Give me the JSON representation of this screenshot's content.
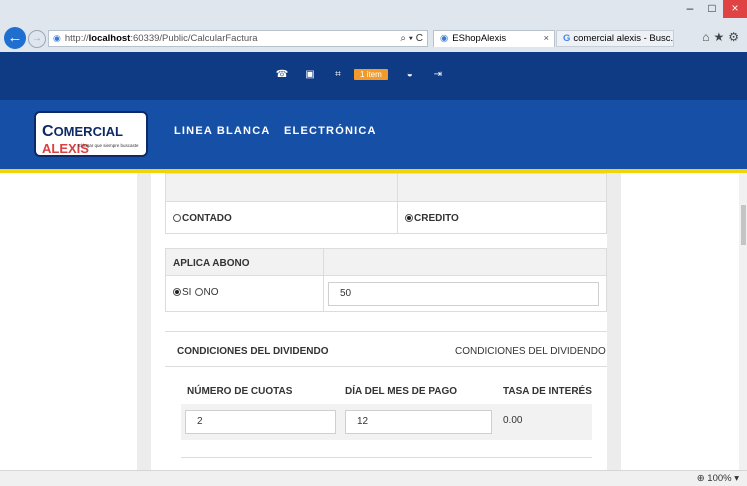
{
  "browser": {
    "url_prefix": "http://",
    "url_host": "localhost",
    "url_path": ":60339/Public/CalcularFactura",
    "search_tools": "⌕ ▾ C",
    "tab_active": "EShopAlexis",
    "tab_inactive": "comercial alexis - Busc...",
    "tab_close": "×",
    "min_label": "–",
    "max_label": "□",
    "close_label": "×",
    "right_icons": "⌂★⚙"
  },
  "topbar": {
    "phone_icon": "☎",
    "user_icon": "▣",
    "cart_icon": "⌗",
    "cart_badge": "1 item",
    "dashboard_icon": "◒",
    "logout_icon": "⇥"
  },
  "logo": {
    "main": "OMERCIAL",
    "prefix": "C",
    "accent": "ALEXIS",
    "tagline": "El lugar que siempre buscaste"
  },
  "nav": {
    "items": [
      "LINEA BLANCA",
      "ELECTRÓNICA"
    ]
  },
  "payment": {
    "contado_label": "CONTADO",
    "credito_label": "CREDITO"
  },
  "abono": {
    "header": "APLICA ABONO",
    "si_label": "SI",
    "no_label": "NO",
    "amount": "50"
  },
  "dividendo": {
    "title": "CONDICIONES DEL DIVIDENDO",
    "title_right": "CONDICIONES DEL DIVIDENDO",
    "col_cuotas": "NÚMERO DE CUOTAS",
    "col_dia": "DÍA DEL MES DE PAGO",
    "col_tasa": "TASA DE INTERÉS",
    "cuotas": "2",
    "dia": "12",
    "tasa": "0.00"
  },
  "status": {
    "zoom": "⊕ 100% ▾"
  }
}
